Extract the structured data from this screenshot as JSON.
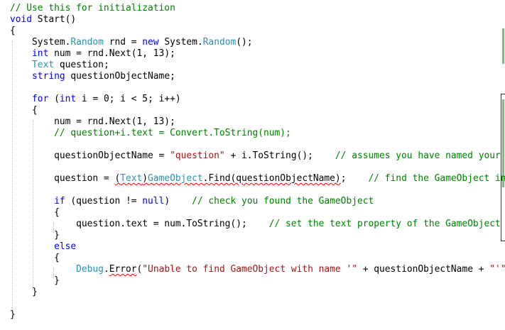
{
  "code": {
    "l1_comment": "// Use this for initialization",
    "l2_kw": "void",
    "l2_name": " Start()",
    "l3": "{",
    "l4_indent": "    ",
    "l4_t1": "System.",
    "l4_t2": "Random",
    "l4_t3": " rnd = ",
    "l4_t4": "new",
    "l4_t5": " System.",
    "l4_t6": "Random",
    "l4_t7": "();",
    "l5_indent": "    ",
    "l5_kw": "int",
    "l5_rest": " num = rnd.Next(1, 13);",
    "l6_indent": "    ",
    "l6_ty": "Text",
    "l6_rest": " question;",
    "l7_indent": "    ",
    "l7_kw": "string",
    "l7_rest": " questionObjectName;",
    "l9_indent": "    ",
    "l9_kw1": "for",
    "l9_t1": " (",
    "l9_kw2": "int",
    "l9_t2": " i = 0; i < 5; i++)",
    "l10": "    {",
    "l11_rest": "        num = rnd.Next(1, 13);",
    "l12_indent": "        ",
    "l12_comment": "// question+i.text = Convert.ToString(num);",
    "l14_t1": "        questionObjectName = ",
    "l14_str": "\"question\"",
    "l14_t2": " + i.ToString();    ",
    "l14_comment": "// assumes you have named your textboxes",
    "l16_t1": "        question = ",
    "l16_sq1": "(",
    "l16_sq_ty1": "Text",
    "l16_sq2": ")",
    "l16_sq_ty2": "GameObject",
    "l16_sq3": ".Find(questionObjectName)",
    "l16_t2": ";    ",
    "l16_comment": "// find the GameObject in the scen",
    "l18_indent": "        ",
    "l18_kw1": "if",
    "l18_t1": " (question != ",
    "l18_kw2": "null",
    "l18_t2": ")    ",
    "l18_comment": "// check you found the GameObject",
    "l19": "        {",
    "l20_t1": "            question.text = num.ToString();    ",
    "l20_comment": "// set the text property of the GameObject",
    "l21": "        }",
    "l22_indent": "        ",
    "l22_kw": "else",
    "l23": "        {",
    "l24_indent": "            ",
    "l24_ty": "Debug",
    "l24_t1": ".",
    "l24_err": "Error",
    "l24_t2": "(",
    "l24_str1": "\"Unable to find GameObject with name '\"",
    "l24_t3": " + questionObjectName + ",
    "l24_str2": "\"'\"",
    "l24_t4": ");",
    "l25": "        }",
    "l26": "    }",
    "l28": "}"
  },
  "colors": {
    "keyword": "#0000ff",
    "type": "#2b91af",
    "comment": "#008000",
    "string": "#a31515",
    "text": "#000000",
    "squiggle": "#ff0000",
    "change_marker": "#6ccb6c"
  }
}
